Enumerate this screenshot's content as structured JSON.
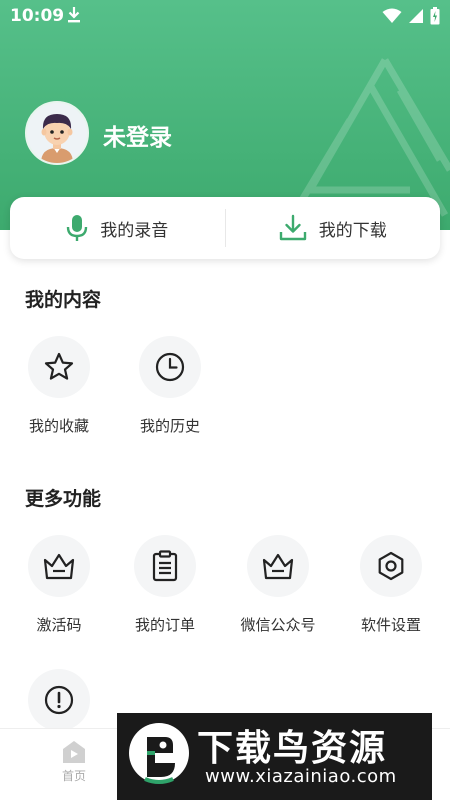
{
  "status_bar": {
    "time": "10:09"
  },
  "profile": {
    "username": "未登录"
  },
  "quick_actions": [
    {
      "label": "我的录音",
      "icon": "microphone-icon"
    },
    {
      "label": "我的下载",
      "icon": "download-icon"
    }
  ],
  "my_content": {
    "title": "我的内容",
    "items": [
      {
        "label": "我的收藏",
        "icon": "star-icon"
      },
      {
        "label": "我的历史",
        "icon": "clock-icon"
      }
    ]
  },
  "more_features": {
    "title": "更多功能",
    "items": [
      {
        "label": "激活码",
        "icon": "crown-icon"
      },
      {
        "label": "我的订单",
        "icon": "clipboard-icon"
      },
      {
        "label": "微信公众号",
        "icon": "crown-icon"
      },
      {
        "label": "软件设置",
        "icon": "settings-hexagon-icon"
      },
      {
        "label": "",
        "icon": "info-exclamation-icon"
      }
    ]
  },
  "bottom_nav": {
    "home_label": "首页"
  },
  "watermark": {
    "title": "下载鸟资源",
    "url": "www.xiazainiao.com"
  },
  "colors": {
    "accent": "#3daa6e",
    "header_top": "#56c08a",
    "icon_dark": "#222222"
  }
}
